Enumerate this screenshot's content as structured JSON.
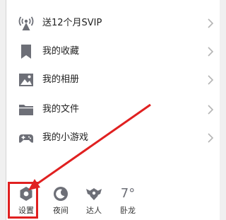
{
  "menu": {
    "items": [
      {
        "label": "送12个月SVIP",
        "icon": "antenna-broadcast-icon"
      },
      {
        "label": "我的收藏",
        "icon": "bookmark-icon"
      },
      {
        "label": "我的相册",
        "icon": "image-icon"
      },
      {
        "label": "我的文件",
        "icon": "folder-icon"
      },
      {
        "label": "我的小游戏",
        "icon": "gamepad-icon"
      }
    ]
  },
  "bottom_bar": {
    "settings_label": "设置",
    "night_label": "夜间",
    "expert_label": "达人",
    "weather_location": "卧龙",
    "weather_temp": "7°"
  },
  "colors": {
    "icon_gray": "#6d6f77",
    "annotation_red": "#e02020",
    "text": "#222222"
  }
}
